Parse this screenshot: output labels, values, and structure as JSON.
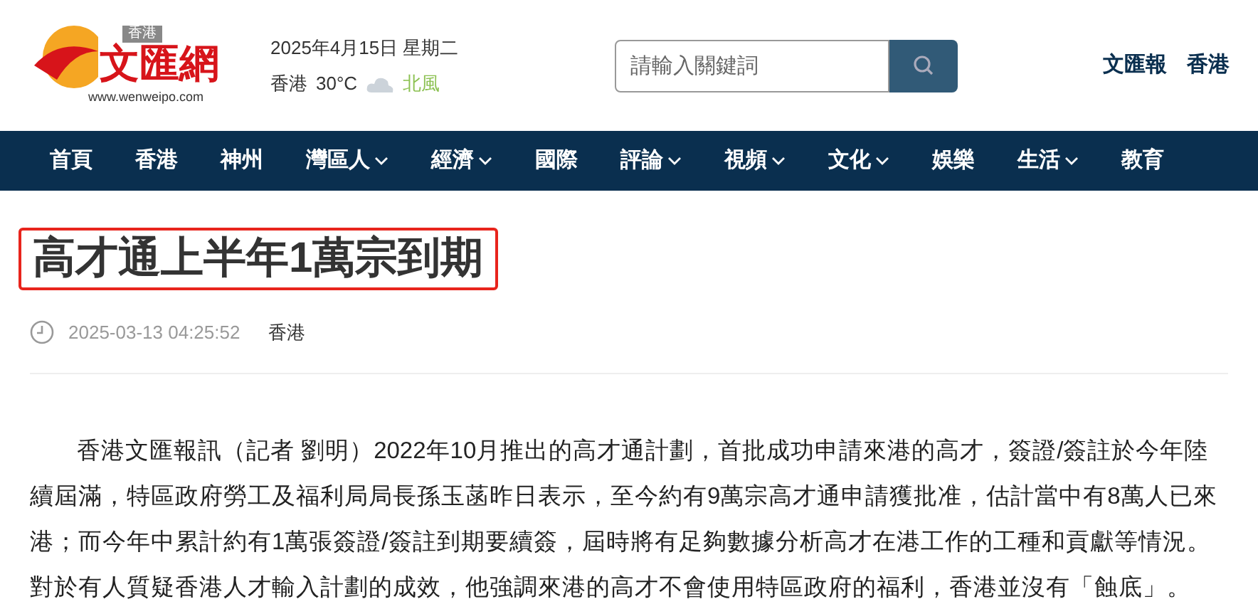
{
  "logo": {
    "region": "香港",
    "name": "文匯網",
    "url": "www.wenweipo.com"
  },
  "date": "2025年4月15日 星期二",
  "weather": {
    "city": "香港",
    "temperature": "30°C",
    "wind": "北風"
  },
  "search": {
    "placeholder": "請輸入關鍵詞"
  },
  "header_links": [
    "文匯報",
    "香港"
  ],
  "nav": [
    {
      "label": "首頁",
      "has_menu": false
    },
    {
      "label": "香港",
      "has_menu": false
    },
    {
      "label": "神州",
      "has_menu": false
    },
    {
      "label": "灣區人",
      "has_menu": true
    },
    {
      "label": "經濟",
      "has_menu": true
    },
    {
      "label": "國際",
      "has_menu": false
    },
    {
      "label": "評論",
      "has_menu": true
    },
    {
      "label": "視頻",
      "has_menu": true
    },
    {
      "label": "文化",
      "has_menu": true
    },
    {
      "label": "娛樂",
      "has_menu": false
    },
    {
      "label": "生活",
      "has_menu": true
    },
    {
      "label": "教育",
      "has_menu": false
    }
  ],
  "article": {
    "title": "高才通上半年1萬宗到期",
    "timestamp": "2025-03-13 04:25:52",
    "location": "香港",
    "body": "香港文匯報訊（記者 劉明）2022年10月推出的高才通計劃，首批成功申請來港的高才，簽證/簽註於今年陸續屆滿，特區政府勞工及福利局局長孫玉菡昨日表示，至今約有9萬宗高才通申請獲批准，估計當中有8萬人已來港；而今年中累計約有1萬張簽證/簽註到期要續簽，屆時將有足夠數據分析高才在港工作的工種和貢獻等情況。對於有人質疑香港人才輸入計劃的成效，他強調來港的高才不會使用特區政府的福利，香港並沒有「蝕底」。"
  }
}
